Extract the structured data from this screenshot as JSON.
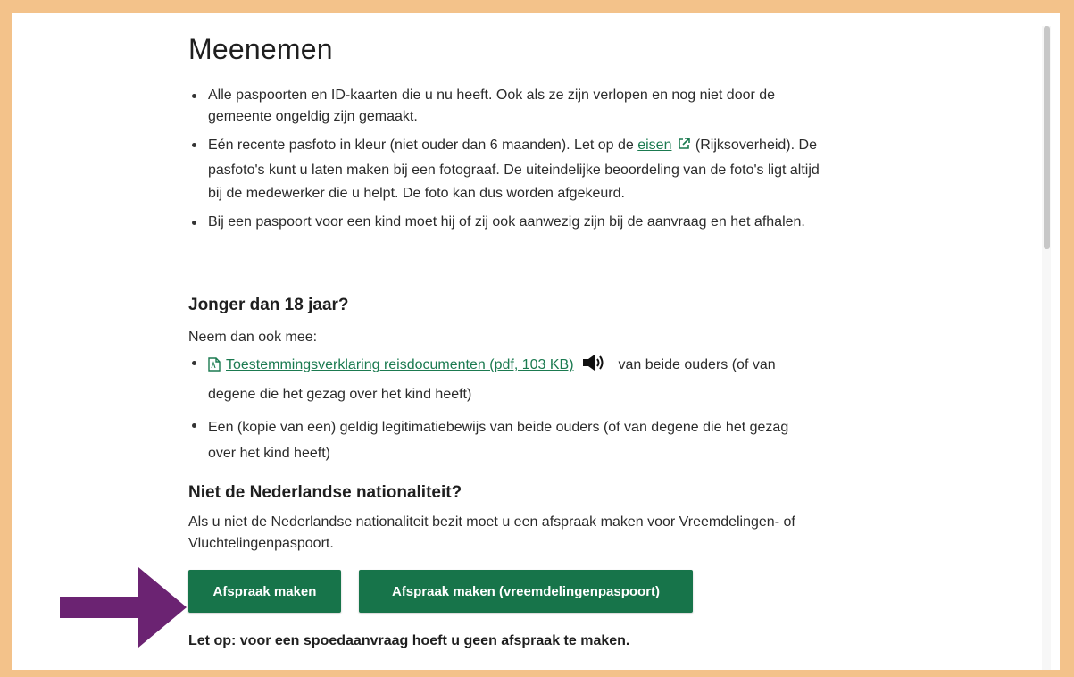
{
  "heading": "Meenemen",
  "meenemen_items": [
    {
      "text": "Alle paspoorten en ID-kaarten die u nu heeft. Ook als ze zijn verlopen en nog niet door de gemeente ongeldig zijn gemaakt."
    },
    {
      "before": "Eén recente pasfoto in kleur (niet ouder dan 6 maanden). Let op de ",
      "link": "eisen",
      "after": "(Rijksoverheid). De pasfoto's kunt u laten maken bij een fotograaf. De uiteindelijke beoordeling van de foto's ligt altijd bij de medewerker die u helpt. De foto kan dus worden afgekeurd."
    },
    {
      "text": "Bij een paspoort voor een kind moet hij of zij ook aanwezig zijn bij de aanvraag en het afhalen."
    }
  ],
  "under18": {
    "heading": "Jonger dan 18 jaar?",
    "intro": "Neem dan ook mee:",
    "items": [
      {
        "link": "Toestemmingsverklaring reisdocumenten (pdf, 103 KB)",
        "after": "van beide ouders (of van degene die het gezag over het kind heeft)"
      },
      {
        "text": "Een (kopie van een) geldig legitimatiebewijs van beide ouders (of van degene die het gezag over het kind heeft)"
      }
    ]
  },
  "nationality": {
    "heading": "Niet de Nederlandse nationaliteit?",
    "text": "Als u niet de Nederlandse nationaliteit bezit moet u een afspraak maken voor Vreemdelingen- of Vluchtelingenpaspoort."
  },
  "buttons": {
    "primary": "Afspraak maken",
    "secondary": "Afspraak maken (vreemdelingenpaspoort)"
  },
  "note": "Let op: voor een spoedaanvraag hoeft u geen afspraak te maken.",
  "colors": {
    "frame": "#F3C28A",
    "button": "#17744A",
    "link": "#1B7A50",
    "arrow": "#6B2372"
  },
  "icons": {
    "external_link": "external-link-icon",
    "pdf": "pdf-icon",
    "speaker": "speaker-icon",
    "arrow": "arrow-right-icon"
  }
}
